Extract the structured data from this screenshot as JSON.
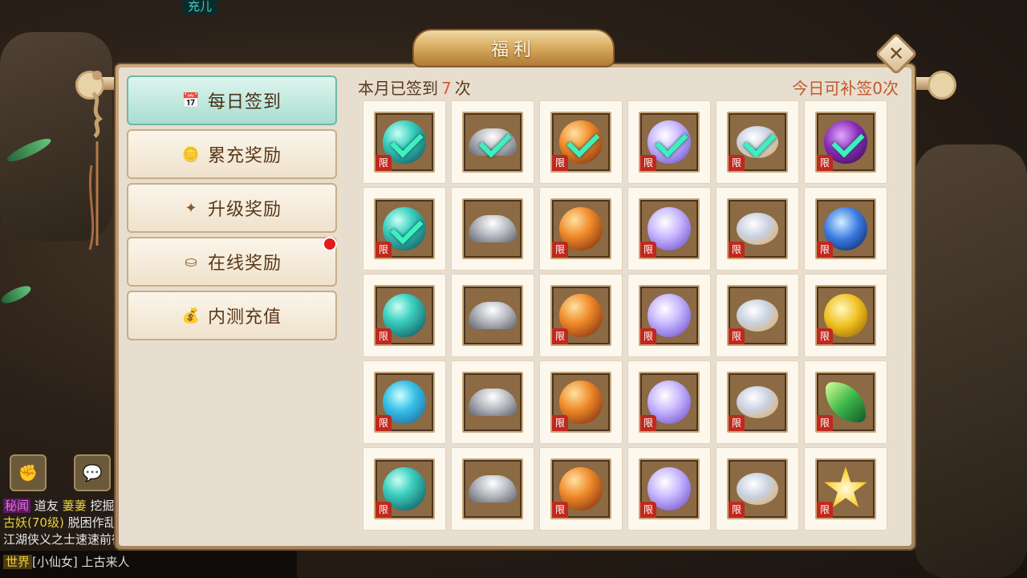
{
  "background": {
    "top_tag": "充儿",
    "chat_lines": [
      {
        "tag": "秘闻",
        "text_a": "道友",
        "name": "萋萋",
        "text_b": "挖掘"
      },
      {
        "name": "古妖(70级)",
        "text_b": "脱困作乱"
      },
      {
        "text_a": "江湖侠义之士速速前往"
      }
    ],
    "world_chat": {
      "channel": "世界",
      "speaker": "[小仙女]",
      "text": "上古来人"
    },
    "bottom_icons": [
      "fist-icon",
      "chat-bubble-icon"
    ]
  },
  "panel": {
    "title": "福利",
    "close_icon": "✕"
  },
  "sidebar": {
    "items": [
      {
        "label": "每日签到",
        "icon": "calendar-icon",
        "glyph": "📅",
        "active": true,
        "badge": false
      },
      {
        "label": "累充奖励",
        "icon": "coins-icon",
        "glyph": "🪙",
        "active": false,
        "badge": false
      },
      {
        "label": "升级奖励",
        "icon": "level-up-icon",
        "glyph": "✦",
        "active": false,
        "badge": false
      },
      {
        "label": "在线奖励",
        "icon": "treasure-icon",
        "glyph": "⛀",
        "active": false,
        "badge": true
      },
      {
        "label": "内测充值",
        "icon": "money-bag-icon",
        "glyph": "💰",
        "active": false,
        "badge": false
      }
    ]
  },
  "signin": {
    "signed_prefix": "本月已签到",
    "signed_count": "7",
    "signed_suffix": "次",
    "resign_text": "今日可补签0次",
    "limit_label": "限",
    "rows": [
      [
        {
          "item": "teal-orb",
          "kind": "teal",
          "claimed": true,
          "limited": true
        },
        {
          "item": "silver-ingot",
          "kind": "silver",
          "claimed": true,
          "limited": false
        },
        {
          "item": "fire-orb",
          "kind": "fire",
          "claimed": true,
          "limited": true
        },
        {
          "item": "lavender-orb",
          "kind": "lavender",
          "claimed": true,
          "limited": true
        },
        {
          "item": "spirit-egg",
          "kind": "egg",
          "claimed": true,
          "limited": true
        },
        {
          "item": "purple-orb",
          "kind": "purple",
          "claimed": true,
          "limited": true
        }
      ],
      [
        {
          "item": "teal-orb",
          "kind": "teal",
          "claimed": true,
          "limited": true
        },
        {
          "item": "silver-ingot",
          "kind": "silver",
          "claimed": false,
          "limited": false
        },
        {
          "item": "fire-orb",
          "kind": "fire",
          "claimed": false,
          "limited": true
        },
        {
          "item": "lavender-orb",
          "kind": "lavender",
          "claimed": false,
          "limited": true
        },
        {
          "item": "spirit-egg",
          "kind": "egg",
          "claimed": false,
          "limited": true
        },
        {
          "item": "blue-crystal",
          "kind": "blue",
          "claimed": false,
          "limited": true
        }
      ],
      [
        {
          "item": "teal-orb",
          "kind": "teal",
          "claimed": false,
          "limited": true
        },
        {
          "item": "silver-ingot",
          "kind": "silver",
          "claimed": false,
          "limited": false
        },
        {
          "item": "fire-orb",
          "kind": "fire",
          "claimed": false,
          "limited": true
        },
        {
          "item": "lavender-orb",
          "kind": "lavender",
          "claimed": false,
          "limited": true
        },
        {
          "item": "spirit-egg",
          "kind": "egg",
          "claimed": false,
          "limited": true
        },
        {
          "item": "gold-orb",
          "kind": "gold",
          "claimed": false,
          "limited": true
        }
      ],
      [
        {
          "item": "swirl-orb",
          "kind": "swirl",
          "claimed": false,
          "limited": true
        },
        {
          "item": "silver-ingot",
          "kind": "silver",
          "claimed": false,
          "limited": false
        },
        {
          "item": "fire-orb",
          "kind": "fire",
          "claimed": false,
          "limited": true
        },
        {
          "item": "lavender-orb",
          "kind": "lavender",
          "claimed": false,
          "limited": true
        },
        {
          "item": "spirit-egg",
          "kind": "egg",
          "claimed": false,
          "limited": true
        },
        {
          "item": "green-leaf",
          "kind": "leaf",
          "claimed": false,
          "limited": true
        }
      ],
      [
        {
          "item": "teal-orb",
          "kind": "teal",
          "claimed": false,
          "limited": true
        },
        {
          "item": "silver-ingot",
          "kind": "silver",
          "claimed": false,
          "limited": false
        },
        {
          "item": "fire-orb",
          "kind": "fire",
          "claimed": false,
          "limited": true
        },
        {
          "item": "lavender-orb",
          "kind": "lavender",
          "claimed": false,
          "limited": true
        },
        {
          "item": "spirit-egg",
          "kind": "egg",
          "claimed": false,
          "limited": true
        },
        {
          "item": "gold-star",
          "kind": "star",
          "claimed": false,
          "limited": true
        }
      ]
    ]
  },
  "colors": {
    "accent_teal": "#a9ded0",
    "count_highlight": "#e05a30",
    "limit_red": "#c0281e",
    "check_green": "#3ef0c0"
  }
}
